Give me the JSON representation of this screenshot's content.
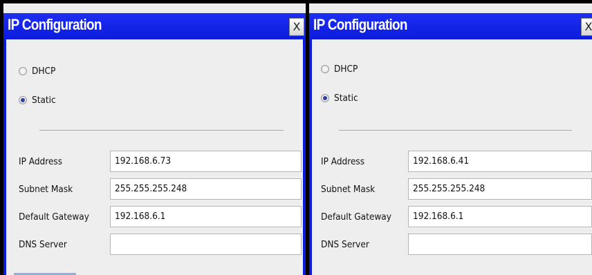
{
  "panels": [
    {
      "title": "IP Configuration",
      "close_label": "X",
      "mode_options": [
        {
          "label": "DHCP",
          "selected": false
        },
        {
          "label": "Static",
          "selected": true
        }
      ],
      "fields": [
        {
          "label": "IP Address",
          "value": "192.168.6.73"
        },
        {
          "label": "Subnet Mask",
          "value": "255.255.255.248"
        },
        {
          "label": "Default Gateway",
          "value": "192.168.6.1"
        },
        {
          "label": "DNS Server",
          "value": ""
        }
      ]
    },
    {
      "title": "IP Configuration",
      "close_label": "X",
      "mode_options": [
        {
          "label": "DHCP",
          "selected": false
        },
        {
          "label": "Static",
          "selected": true
        }
      ],
      "fields": [
        {
          "label": "IP Address",
          "value": "192.168.6.41"
        },
        {
          "label": "Subnet Mask",
          "value": "255.255.255.248"
        },
        {
          "label": "Default Gateway",
          "value": "192.168.6.1"
        },
        {
          "label": "DNS Server",
          "value": ""
        }
      ]
    }
  ],
  "colors": {
    "titlebar": "#0a1bdc",
    "title_text": "#ffffff",
    "window_bg": "#eeeeee",
    "radio_selected": "#2b3fa8"
  }
}
